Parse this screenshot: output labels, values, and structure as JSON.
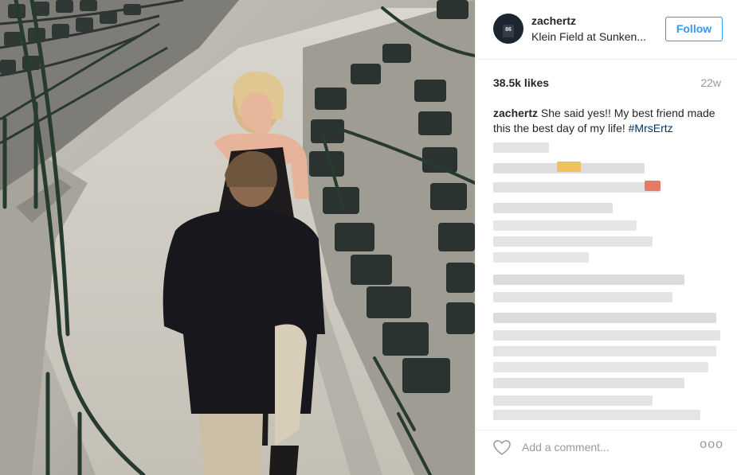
{
  "post": {
    "username": "zachertz",
    "location": "Klein Field at Sunken...",
    "follow_label": "Follow",
    "likes": "38.5k likes",
    "age": "22w",
    "caption": {
      "username": "zachertz",
      "text": "She said yes!! My best friend made this the best day of my life!",
      "hashtag": "#MrsErtz"
    },
    "comment_placeholder": "Add a comment...",
    "more_label": "ooo"
  },
  "avatar": {
    "jersey_number": "86"
  },
  "colors": {
    "accent": "#3897f0",
    "hashtag": "#003569",
    "muted": "#999999",
    "text": "#262626"
  },
  "icons": {
    "like": "heart-icon",
    "more": "more-options-icon"
  }
}
